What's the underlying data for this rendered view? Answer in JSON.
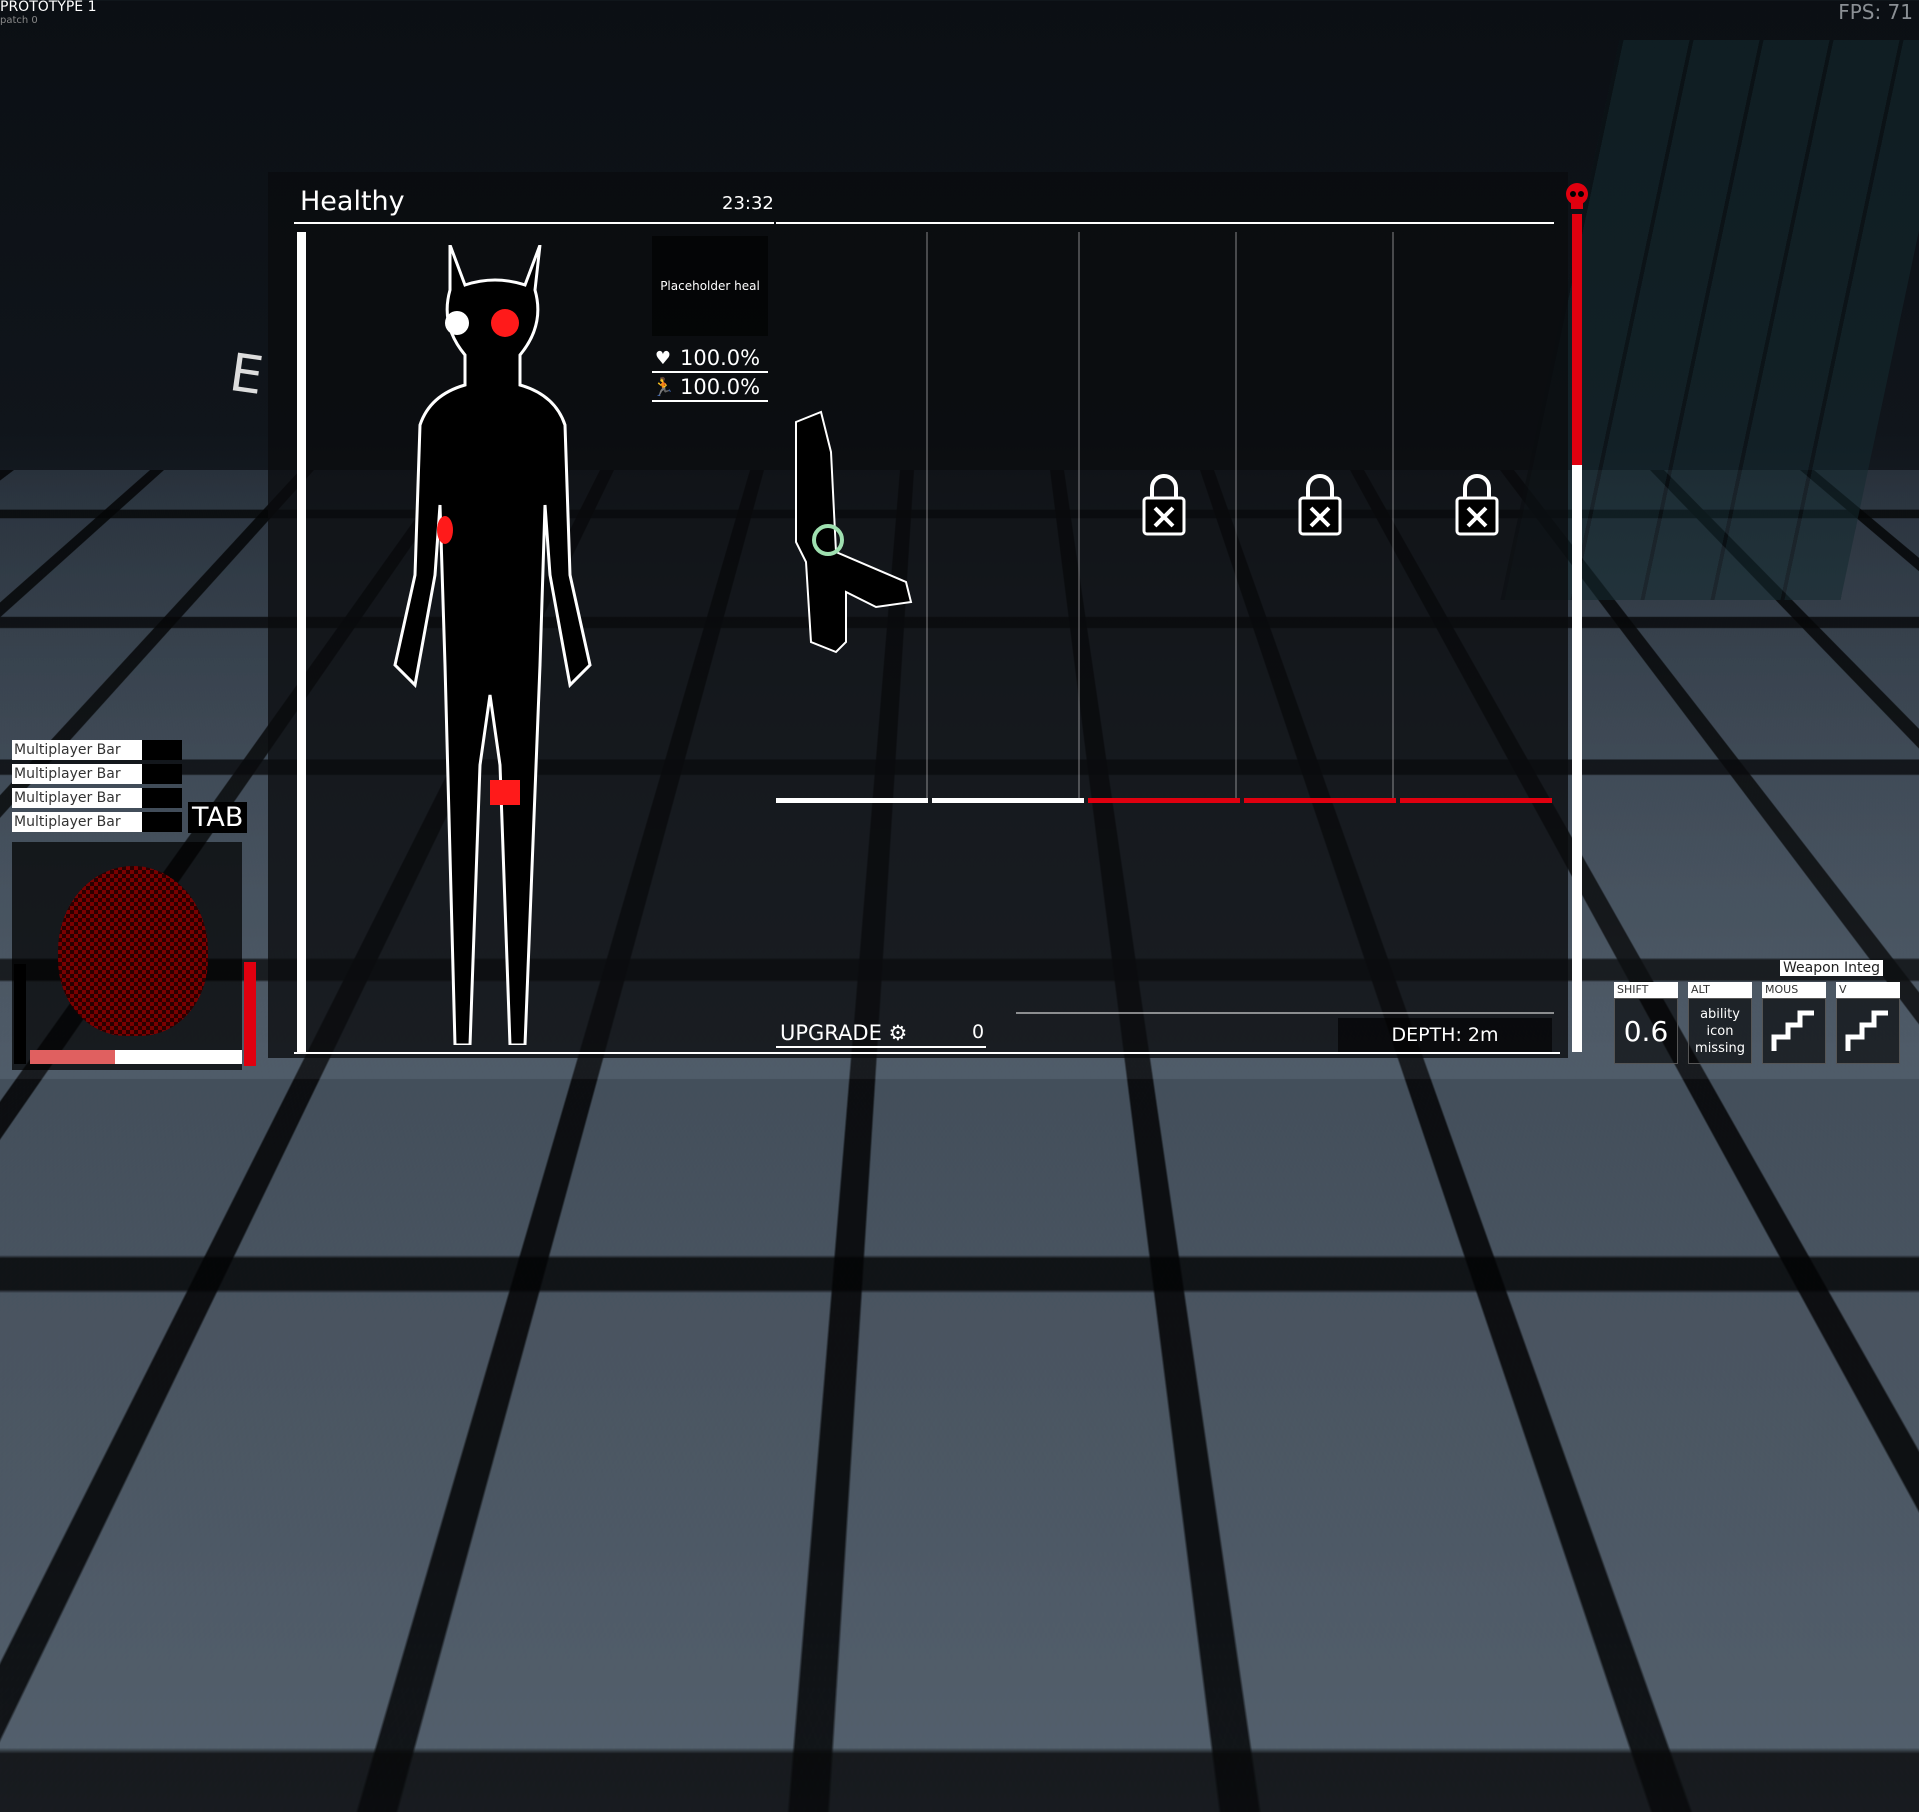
{
  "game": {
    "title": "PROTOTYPE 1",
    "patch": "patch 0",
    "fps_label": "FPS: 71"
  },
  "status_panel": {
    "condition": "Healthy",
    "time": "23:32",
    "heal_label": "Placeholder heal",
    "health_stat": "100.0%",
    "stamina_stat": "100.0%",
    "upgrade_label": "UPGRADE",
    "upgrade_count": "0",
    "depth_label": "DEPTH: 2m",
    "danger_level": 0.3
  },
  "weapon_slots": [
    {
      "state": "equipped",
      "bar_color": "#ffffff"
    },
    {
      "state": "empty",
      "bar_color": "#ffffff"
    },
    {
      "state": "locked",
      "bar_color": "#e0000f"
    },
    {
      "state": "locked",
      "bar_color": "#e0000f"
    },
    {
      "state": "locked",
      "bar_color": "#e0000f"
    }
  ],
  "multiplayer": {
    "bars": [
      "Multiplayer Bar",
      "Multiplayer Bar",
      "Multiplayer Bar",
      "Multiplayer Bar"
    ],
    "tab_label": "TAB",
    "portrait_health": 0.4
  },
  "abilities": {
    "title": "Weapon Integ",
    "items": [
      {
        "key": "SHIFT",
        "value": "0.6"
      },
      {
        "key": "ALT",
        "value": "ability icon missing"
      },
      {
        "key": "MOUS",
        "value": ""
      },
      {
        "key": "V",
        "value": ""
      }
    ]
  },
  "colors": {
    "accent_red": "#e0000f",
    "panel_bg": "#0a0c0e"
  }
}
